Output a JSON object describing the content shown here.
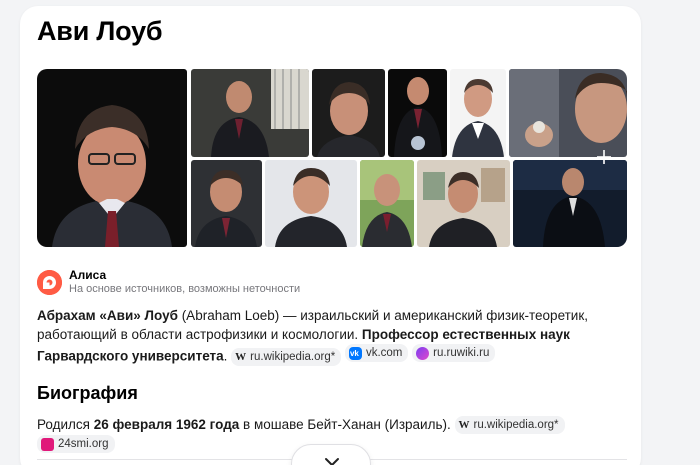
{
  "title": "Ави Лоуб",
  "alice": {
    "name": "Алиса",
    "subtitle": "На основе источников, возможны неточности"
  },
  "summary": {
    "bold_name": "Абрахам «Ави» Лоуб",
    "latin_name": "(Abraham Loeb)",
    "text": " — израильский и американский физик-теоретик, работающий в области астрофизики и космологии. ",
    "bold_text": "Профессор естественных наук Гарвардского университета",
    "end": ".",
    "sources": [
      "ru.wikipedia.org*",
      "vk.com",
      "ru.ruwiki.ru"
    ]
  },
  "biography": {
    "heading": "Биография",
    "text_before": "Родился ",
    "bold_date": "26 февраля 1962 года",
    "text_after": " в мошаве Бейт-Ханан (Израиль).",
    "sources": [
      "ru.wikipedia.org*",
      "24smi.org"
    ]
  },
  "colors": {
    "alice": "#ff5b44",
    "vk": "#0077ff",
    "smi": "#e0197a"
  }
}
